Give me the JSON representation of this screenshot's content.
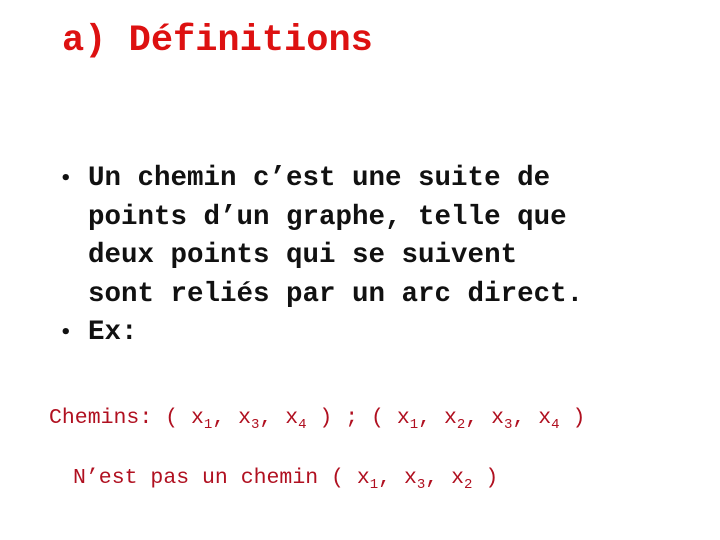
{
  "title": "a) Définitions",
  "bullets": [
    {
      "lines": [
        "Un chemin c’est une suite de",
        "points d’un graphe, telle que",
        "deux points qui se suivent",
        "sont reliés par un arc direct."
      ]
    },
    {
      "lines": [
        "Ex:"
      ]
    }
  ],
  "examples": {
    "paths_label": "Chemins:",
    "paths": [
      [
        "x1",
        "x3",
        "x4"
      ],
      [
        "x1",
        "x2",
        "x3",
        "x4"
      ]
    ],
    "path_separator": ";",
    "not_path_label": "N’est pas un chemin",
    "not_path": [
      "x1",
      "x3",
      "x2"
    ]
  },
  "colors": {
    "title": "#dd1111",
    "body_text": "#111111",
    "examples_text": "#b01020"
  }
}
